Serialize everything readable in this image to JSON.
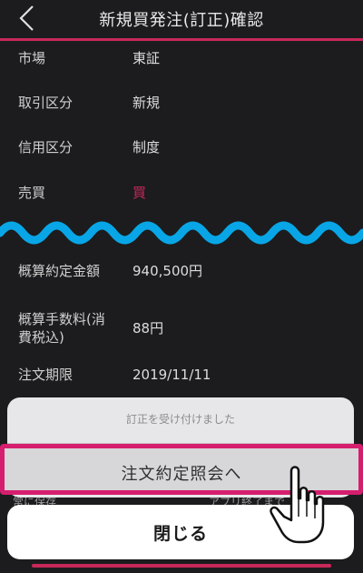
{
  "header": {
    "title": "新規買発注(訂正)確認"
  },
  "rows": [
    {
      "label": "市場",
      "value": "東証"
    },
    {
      "label": "取引区分",
      "value": "新規"
    },
    {
      "label": "信用区分",
      "value": "制度"
    },
    {
      "label": "売買",
      "value": "買"
    },
    {
      "label": "概算約定金額",
      "value": "940,500円"
    },
    {
      "label": "概算手数料(消",
      "label2": "費税込)",
      "value": "88円"
    },
    {
      "label": "注文期限",
      "value": "2019/11/11"
    }
  ],
  "dim": {
    "left": "常に保存",
    "right": "アプリ終了まで"
  },
  "sheet": {
    "message": "訂正を受け付けました"
  },
  "actions": {
    "primary": "注文約定照会へ",
    "close": "閉じる"
  },
  "colors": {
    "accent": "#c8285a",
    "highlight": "#d61e6e",
    "wave": "#08a6e6"
  }
}
